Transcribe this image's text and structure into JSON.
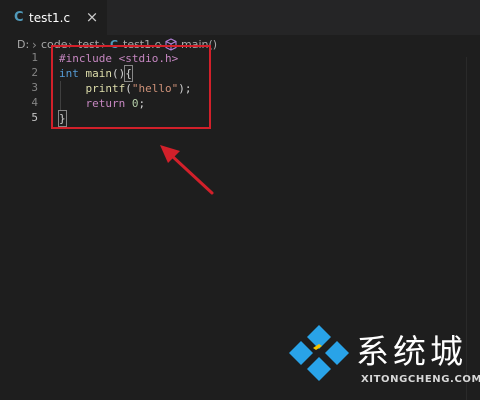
{
  "editor": {
    "tab": {
      "file_icon": "C",
      "file_name": "test1.c",
      "close_glyph": "×"
    },
    "breadcrumb": {
      "items": [
        "D:",
        "code",
        "test",
        "test1.c",
        "main()"
      ],
      "file_icon": "C",
      "separator": "›"
    },
    "line_numbers": [
      "1",
      "2",
      "3",
      "4",
      "5"
    ],
    "code": {
      "line1": {
        "text": "#include <stdio.h>"
      },
      "line2": {
        "type": "int",
        "name": "main",
        "parens": "()",
        "brace": "{"
      },
      "line3": {
        "indent": "    ",
        "fn": "printf",
        "open": "(",
        "str": "\"hello\"",
        "close": ");"
      },
      "line4": {
        "indent": "    ",
        "kw": "return",
        "num": "0",
        "semi": ";"
      },
      "line5": {
        "brace": "}"
      }
    }
  },
  "watermark": {
    "brand_cn": "系统城",
    "brand_en": "XITONGCHENG.COM"
  },
  "colors": {
    "editor_bg": "#1e1e1e",
    "tabbar_bg": "#252526",
    "c_icon": "#519aba",
    "annotation_red": "#d2202a",
    "logo_blue": "#29a3e8"
  }
}
